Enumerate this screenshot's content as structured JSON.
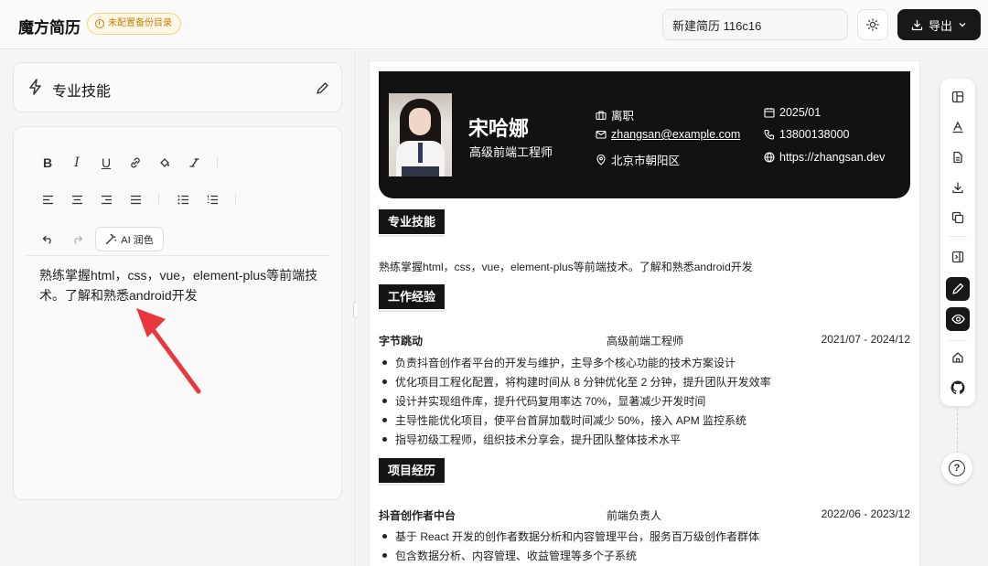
{
  "app": {
    "brand": "魔方简历",
    "badge": "未配置备份目录"
  },
  "header": {
    "resume_title": "新建简历 116c16",
    "export_label": "导出"
  },
  "left": {
    "section_title": "专业技能",
    "editor_content": "熟练掌握html，css，vue，element-plus等前端技术。了解和熟悉android开发",
    "ai_button_label": "AI 润色",
    "toolbar": [
      "bold",
      "italic",
      "underline",
      "link",
      "fill-color",
      "clear-format",
      "align-left",
      "align-center",
      "align-right",
      "justify",
      "bullet-list",
      "ordered-list",
      "undo",
      "redo"
    ]
  },
  "resume": {
    "name": "宋哈娜",
    "title": "高级前端工程师",
    "status": "离职",
    "email": "zhangsan@example.com",
    "location": "北京市朝阳区",
    "date": "2025/01",
    "phone": "13800138000",
    "website": "https://zhangsan.dev",
    "sections": {
      "skills": {
        "heading": "专业技能",
        "text": "熟练掌握html，css，vue，element-plus等前端技术。了解和熟悉android开发"
      },
      "work": {
        "heading": "工作经验",
        "company": "字节跳动",
        "position": "高级前端工程师",
        "period": "2021/07 - 2024/12",
        "bullets": [
          "负责抖音创作者平台的开发与维护，主导多个核心功能的技术方案设计",
          "优化项目工程化配置，将构建时间从 8 分钟优化至 2 分钟，提升团队开发效率",
          "设计并实现组件库，提升代码复用率达 70%，显著减少开发时间",
          "主导性能优化项目，使平台首屏加载时间减少 50%，接入 APM 监控系统",
          "指导初级工程师，组织技术分享会，提升团队整体技术水平"
        ]
      },
      "projects": {
        "heading": "项目经历",
        "name": "抖音创作者中台",
        "role": "前端负责人",
        "period": "2022/06 - 2023/12",
        "bullets": [
          "基于 React 开发的创作者数据分析和内容管理平台，服务百万级创作者群体",
          "包含数据分析、内容管理、收益管理等多个子系统"
        ]
      }
    }
  },
  "right_toolbar": [
    "layout-icon",
    "font-icon",
    "file-icon",
    "download-icon",
    "copy-icon",
    "panel-icon",
    "pen-icon",
    "eye-icon",
    "home-icon",
    "github-icon"
  ],
  "colors": {
    "accent": "#18181b",
    "badge": "#c27c0e",
    "arrow": "#e8383d"
  }
}
